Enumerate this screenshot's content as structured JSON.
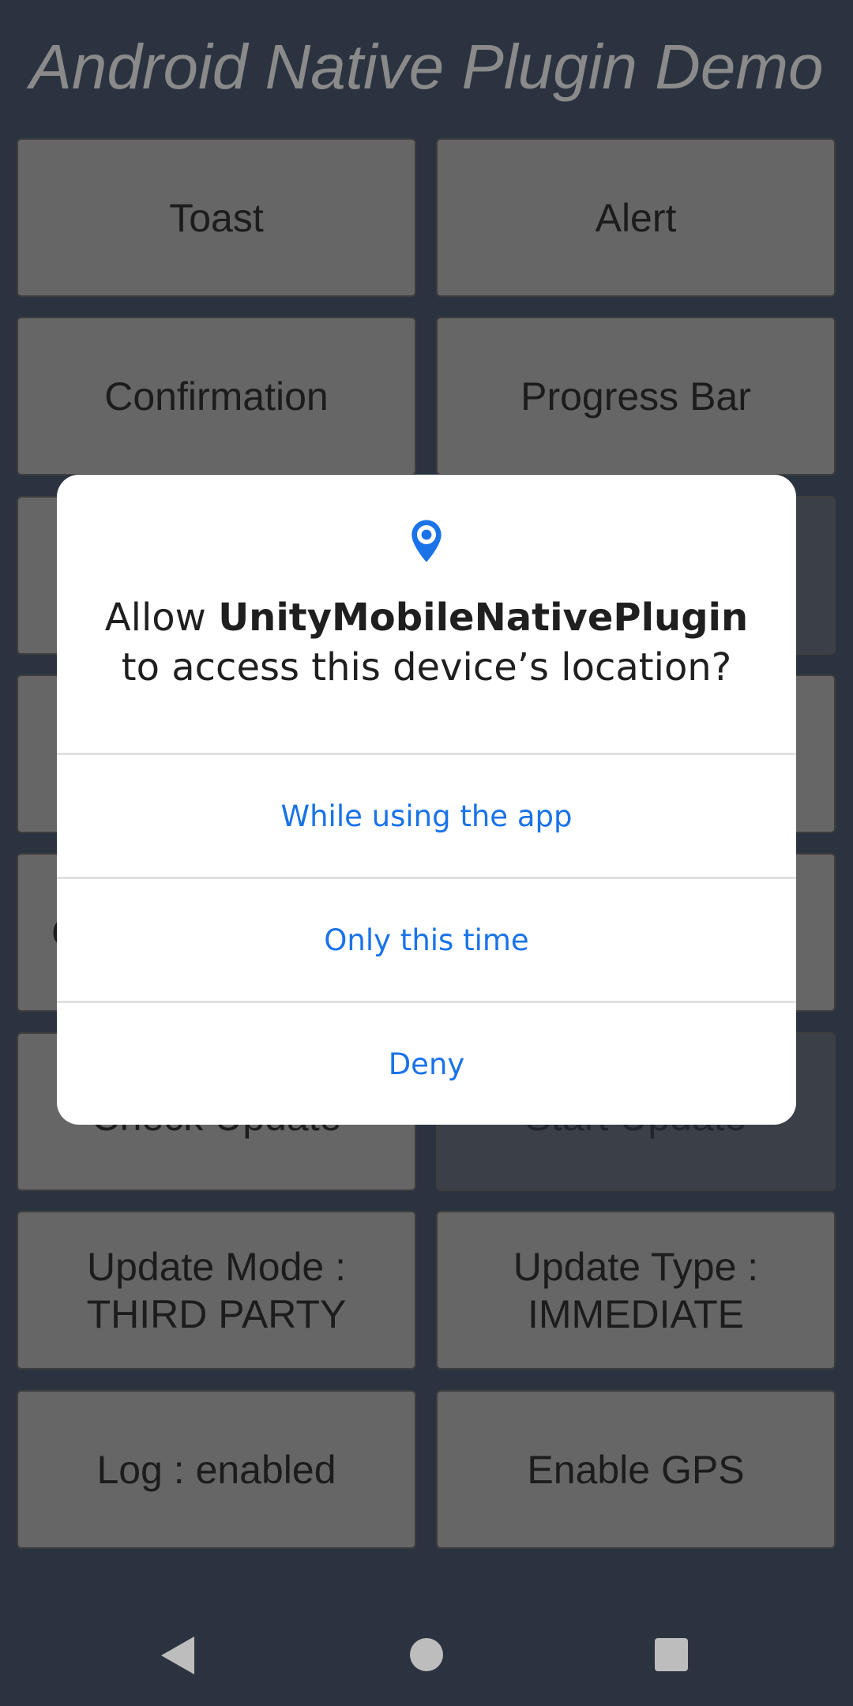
{
  "app": {
    "title": "Android Native Plugin Demo"
  },
  "buttons": [
    {
      "id": "toast",
      "label": "Toast"
    },
    {
      "id": "alert",
      "label": "Alert"
    },
    {
      "id": "confirmation",
      "label": "Confirmation"
    },
    {
      "id": "progress-bar",
      "label": "Progress Bar"
    },
    {
      "id": "hidden-1",
      "label": ""
    },
    {
      "id": "hidden-2",
      "label": ""
    },
    {
      "id": "hidden-3",
      "label": ""
    },
    {
      "id": "hidden-4",
      "label": ""
    },
    {
      "id": "hidden-5",
      "label": "C"
    },
    {
      "id": "hidden-6",
      "label": ""
    },
    {
      "id": "check-update",
      "label": "Check Update"
    },
    {
      "id": "start-update",
      "label": "Start Update"
    },
    {
      "id": "update-mode",
      "label": "Update Mode :\nTHIRD PARTY"
    },
    {
      "id": "update-type",
      "label": "Update Type :\nIMMEDIATE"
    },
    {
      "id": "log",
      "label": "Log :  enabled"
    },
    {
      "id": "enable-gps",
      "label": "Enable GPS"
    }
  ],
  "dialog": {
    "icon": "location-pin-icon",
    "prefix": "Allow ",
    "app_name": "UnityMobileNativePlugin",
    "suffix": "to access this device’s location?",
    "options": {
      "while_using": "While using the app",
      "only_this_time": "Only this time",
      "deny": "Deny"
    }
  },
  "navbar": {
    "back": "back-icon",
    "home": "home-icon",
    "recents": "recents-icon"
  },
  "colors": {
    "background": "#2c3340",
    "button": "#666666",
    "dialog_accent": "#1a73e8"
  }
}
